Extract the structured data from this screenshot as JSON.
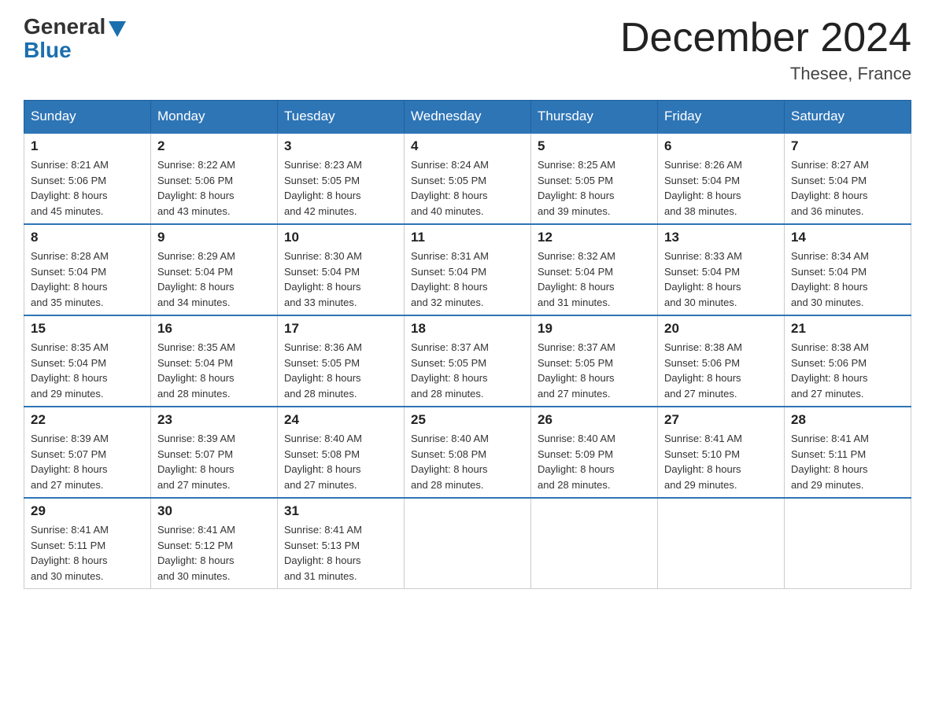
{
  "header": {
    "logo_general": "General",
    "logo_blue": "Blue",
    "month_title": "December 2024",
    "location": "Thesee, France"
  },
  "weekdays": [
    "Sunday",
    "Monday",
    "Tuesday",
    "Wednesday",
    "Thursday",
    "Friday",
    "Saturday"
  ],
  "weeks": [
    [
      {
        "day": "1",
        "sunrise": "8:21 AM",
        "sunset": "5:06 PM",
        "daylight": "8 hours and 45 minutes."
      },
      {
        "day": "2",
        "sunrise": "8:22 AM",
        "sunset": "5:06 PM",
        "daylight": "8 hours and 43 minutes."
      },
      {
        "day": "3",
        "sunrise": "8:23 AM",
        "sunset": "5:05 PM",
        "daylight": "8 hours and 42 minutes."
      },
      {
        "day": "4",
        "sunrise": "8:24 AM",
        "sunset": "5:05 PM",
        "daylight": "8 hours and 40 minutes."
      },
      {
        "day": "5",
        "sunrise": "8:25 AM",
        "sunset": "5:05 PM",
        "daylight": "8 hours and 39 minutes."
      },
      {
        "day": "6",
        "sunrise": "8:26 AM",
        "sunset": "5:04 PM",
        "daylight": "8 hours and 38 minutes."
      },
      {
        "day": "7",
        "sunrise": "8:27 AM",
        "sunset": "5:04 PM",
        "daylight": "8 hours and 36 minutes."
      }
    ],
    [
      {
        "day": "8",
        "sunrise": "8:28 AM",
        "sunset": "5:04 PM",
        "daylight": "8 hours and 35 minutes."
      },
      {
        "day": "9",
        "sunrise": "8:29 AM",
        "sunset": "5:04 PM",
        "daylight": "8 hours and 34 minutes."
      },
      {
        "day": "10",
        "sunrise": "8:30 AM",
        "sunset": "5:04 PM",
        "daylight": "8 hours and 33 minutes."
      },
      {
        "day": "11",
        "sunrise": "8:31 AM",
        "sunset": "5:04 PM",
        "daylight": "8 hours and 32 minutes."
      },
      {
        "day": "12",
        "sunrise": "8:32 AM",
        "sunset": "5:04 PM",
        "daylight": "8 hours and 31 minutes."
      },
      {
        "day": "13",
        "sunrise": "8:33 AM",
        "sunset": "5:04 PM",
        "daylight": "8 hours and 30 minutes."
      },
      {
        "day": "14",
        "sunrise": "8:34 AM",
        "sunset": "5:04 PM",
        "daylight": "8 hours and 30 minutes."
      }
    ],
    [
      {
        "day": "15",
        "sunrise": "8:35 AM",
        "sunset": "5:04 PM",
        "daylight": "8 hours and 29 minutes."
      },
      {
        "day": "16",
        "sunrise": "8:35 AM",
        "sunset": "5:04 PM",
        "daylight": "8 hours and 28 minutes."
      },
      {
        "day": "17",
        "sunrise": "8:36 AM",
        "sunset": "5:05 PM",
        "daylight": "8 hours and 28 minutes."
      },
      {
        "day": "18",
        "sunrise": "8:37 AM",
        "sunset": "5:05 PM",
        "daylight": "8 hours and 28 minutes."
      },
      {
        "day": "19",
        "sunrise": "8:37 AM",
        "sunset": "5:05 PM",
        "daylight": "8 hours and 27 minutes."
      },
      {
        "day": "20",
        "sunrise": "8:38 AM",
        "sunset": "5:06 PM",
        "daylight": "8 hours and 27 minutes."
      },
      {
        "day": "21",
        "sunrise": "8:38 AM",
        "sunset": "5:06 PM",
        "daylight": "8 hours and 27 minutes."
      }
    ],
    [
      {
        "day": "22",
        "sunrise": "8:39 AM",
        "sunset": "5:07 PM",
        "daylight": "8 hours and 27 minutes."
      },
      {
        "day": "23",
        "sunrise": "8:39 AM",
        "sunset": "5:07 PM",
        "daylight": "8 hours and 27 minutes."
      },
      {
        "day": "24",
        "sunrise": "8:40 AM",
        "sunset": "5:08 PM",
        "daylight": "8 hours and 27 minutes."
      },
      {
        "day": "25",
        "sunrise": "8:40 AM",
        "sunset": "5:08 PM",
        "daylight": "8 hours and 28 minutes."
      },
      {
        "day": "26",
        "sunrise": "8:40 AM",
        "sunset": "5:09 PM",
        "daylight": "8 hours and 28 minutes."
      },
      {
        "day": "27",
        "sunrise": "8:41 AM",
        "sunset": "5:10 PM",
        "daylight": "8 hours and 29 minutes."
      },
      {
        "day": "28",
        "sunrise": "8:41 AM",
        "sunset": "5:11 PM",
        "daylight": "8 hours and 29 minutes."
      }
    ],
    [
      {
        "day": "29",
        "sunrise": "8:41 AM",
        "sunset": "5:11 PM",
        "daylight": "8 hours and 30 minutes."
      },
      {
        "day": "30",
        "sunrise": "8:41 AM",
        "sunset": "5:12 PM",
        "daylight": "8 hours and 30 minutes."
      },
      {
        "day": "31",
        "sunrise": "8:41 AM",
        "sunset": "5:13 PM",
        "daylight": "8 hours and 31 minutes."
      },
      null,
      null,
      null,
      null
    ]
  ],
  "labels": {
    "sunrise": "Sunrise:",
    "sunset": "Sunset:",
    "daylight": "Daylight:"
  }
}
